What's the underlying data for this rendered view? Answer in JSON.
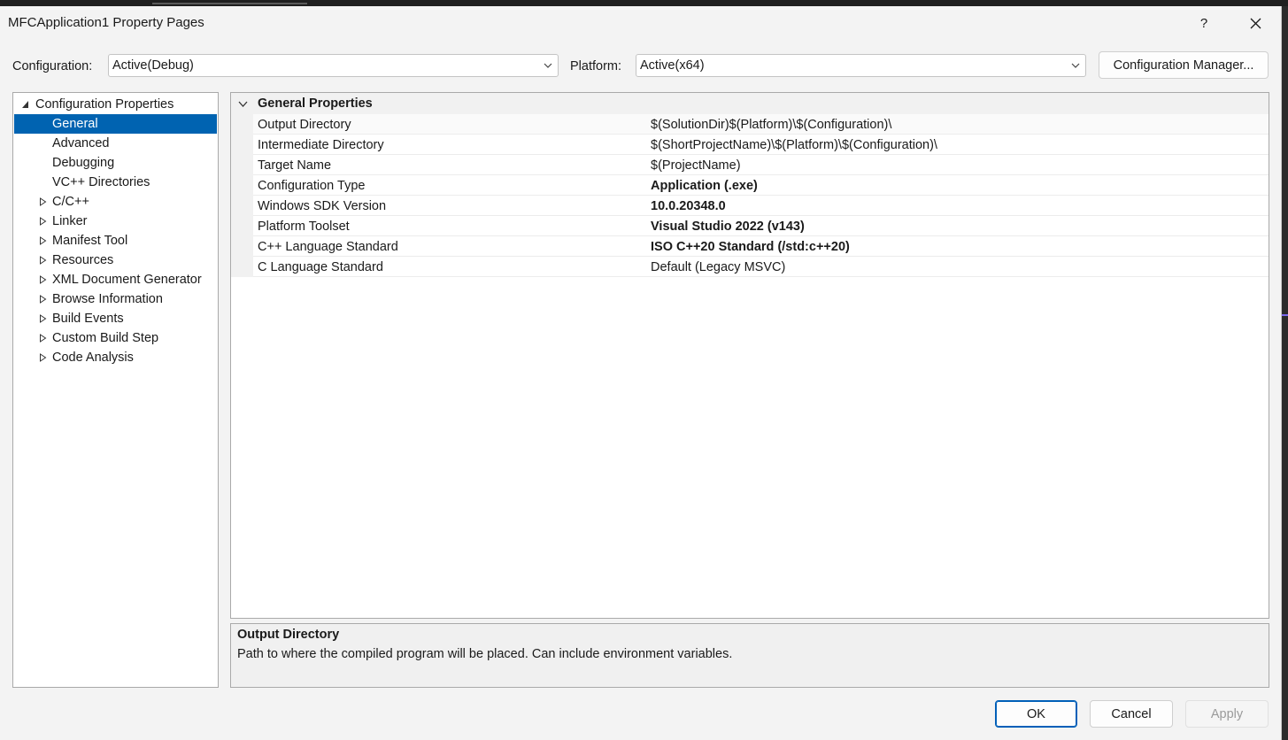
{
  "window": {
    "title": "MFCApplication1 Property Pages",
    "help_label": "?"
  },
  "toolbar": {
    "configuration_label": "Configuration:",
    "configuration_value": "Active(Debug)",
    "platform_label": "Platform:",
    "platform_value": "Active(x64)",
    "config_manager_label": "Configuration Manager..."
  },
  "tree": {
    "root": "Configuration Properties",
    "items": [
      {
        "label": "General",
        "expandable": false,
        "selected": true
      },
      {
        "label": "Advanced",
        "expandable": false
      },
      {
        "label": "Debugging",
        "expandable": false
      },
      {
        "label": "VC++ Directories",
        "expandable": false
      },
      {
        "label": "C/C++",
        "expandable": true
      },
      {
        "label": "Linker",
        "expandable": true
      },
      {
        "label": "Manifest Tool",
        "expandable": true
      },
      {
        "label": "Resources",
        "expandable": true
      },
      {
        "label": "XML Document Generator",
        "expandable": true
      },
      {
        "label": "Browse Information",
        "expandable": true
      },
      {
        "label": "Build Events",
        "expandable": true
      },
      {
        "label": "Custom Build Step",
        "expandable": true
      },
      {
        "label": "Code Analysis",
        "expandable": true
      }
    ]
  },
  "grid": {
    "section_title": "General Properties",
    "rows": [
      {
        "name": "Output Directory",
        "value": "$(SolutionDir)$(Platform)\\$(Configuration)\\",
        "bold": false
      },
      {
        "name": "Intermediate Directory",
        "value": "$(ShortProjectName)\\$(Platform)\\$(Configuration)\\",
        "bold": false
      },
      {
        "name": "Target Name",
        "value": "$(ProjectName)",
        "bold": false
      },
      {
        "name": "Configuration Type",
        "value": "Application (.exe)",
        "bold": true
      },
      {
        "name": "Windows SDK Version",
        "value": "10.0.20348.0",
        "bold": true
      },
      {
        "name": "Platform Toolset",
        "value": "Visual Studio 2022 (v143)",
        "bold": true
      },
      {
        "name": "C++ Language Standard",
        "value": "ISO C++20 Standard (/std:c++20)",
        "bold": true
      },
      {
        "name": "C Language Standard",
        "value": "Default (Legacy MSVC)",
        "bold": false
      }
    ]
  },
  "description": {
    "title": "Output Directory",
    "text": "Path to where the compiled program will be placed. Can include environment variables."
  },
  "buttons": {
    "ok": "OK",
    "cancel": "Cancel",
    "apply": "Apply"
  },
  "colors": {
    "selection": "#0063b1",
    "primary_border": "#005fb8"
  }
}
